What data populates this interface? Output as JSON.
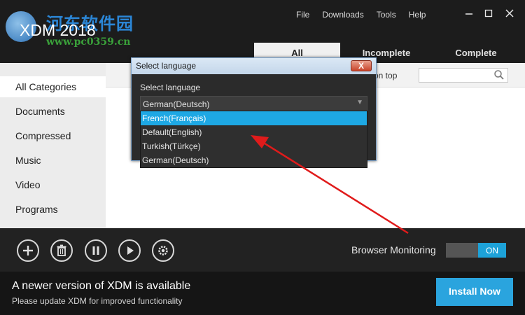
{
  "app": {
    "title": "XDM 2018"
  },
  "watermark": {
    "text": "河东软件园",
    "url": "www.pc0359.cn"
  },
  "menu": {
    "items": [
      "File",
      "Downloads",
      "Tools",
      "Help"
    ]
  },
  "window_controls": {
    "minimize": "—",
    "maximize": "☐",
    "close": "✕"
  },
  "tabs": {
    "all": "All",
    "incomplete": "Incomplete",
    "complete": "Complete"
  },
  "sidebar": {
    "items": [
      "All Categories",
      "Documents",
      "Compressed",
      "Music",
      "Video",
      "Programs"
    ]
  },
  "main": {
    "ontop_label": "on top",
    "search_placeholder": ""
  },
  "actions": {
    "browser_monitoring_label": "Browser Monitoring",
    "toggle_state": "ON",
    "icons": [
      "plus-icon",
      "trash-icon",
      "pause-icon",
      "play-icon",
      "gear-icon"
    ]
  },
  "banner": {
    "title": "A newer version of XDM is available",
    "subtitle": "Please update XDM for improved functionality",
    "install_label": "Install Now"
  },
  "dialog": {
    "title": "Select language",
    "close_label": "X",
    "label": "Select language",
    "selected_value": "German(Deutsch)",
    "options": [
      "French(Français)",
      "Default(English)",
      "Turkish(Türkçe)",
      "German(Deutsch)"
    ],
    "highlighted_option": "French(Français)"
  },
  "colors": {
    "accent": "#1ea8e4",
    "toggle_on": "#1da2d8",
    "install": "#2aa4de",
    "annotation_arrow": "#e01b1b"
  }
}
